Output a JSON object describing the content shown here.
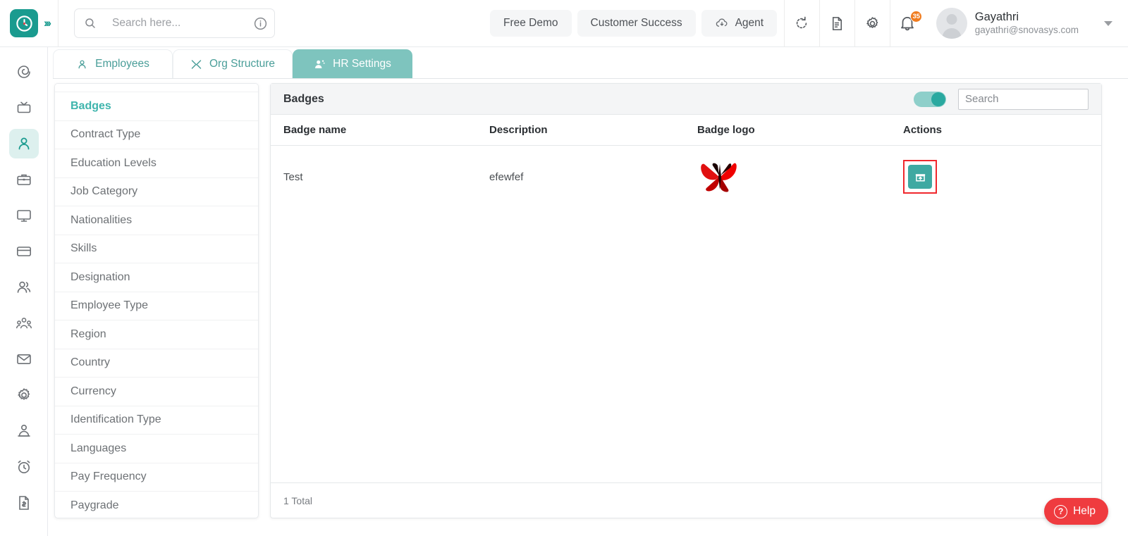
{
  "header": {
    "logo_icon": "clock-logo-icon",
    "collapse_icon": "chevron-double-right-icon",
    "search": {
      "placeholder": "Search here...",
      "value": "",
      "icon": "search-icon",
      "info_icon": "info-circle-icon"
    },
    "buttons": [
      {
        "label": "Free Demo",
        "name": "free-demo-button",
        "icon": ""
      },
      {
        "label": "Customer Success",
        "name": "customer-success-button",
        "icon": ""
      },
      {
        "label": "Agent",
        "name": "agent-button",
        "icon": "cloud-download-icon"
      }
    ],
    "icons": [
      {
        "name": "refresh-icon"
      },
      {
        "name": "document-icon"
      },
      {
        "name": "settings-gear-icon"
      },
      {
        "name": "notifications-bell-icon"
      }
    ],
    "notification_count": "35",
    "user": {
      "name": "Gayathri",
      "email": "gayathri@snovasys.com",
      "avatar": "user-avatar",
      "caret": "chevron-down-icon"
    }
  },
  "rail": {
    "items": [
      {
        "name": "dashboard-spiral-icon",
        "active": false
      },
      {
        "name": "tv-screen-icon",
        "active": false
      },
      {
        "name": "person-icon",
        "active": true
      },
      {
        "name": "briefcase-icon",
        "active": false
      },
      {
        "name": "desktop-monitor-icon",
        "active": false
      },
      {
        "name": "credit-card-icon",
        "active": false
      },
      {
        "name": "users-group-icon",
        "active": false
      },
      {
        "name": "org-people-icon",
        "active": false
      },
      {
        "name": "envelope-mail-icon",
        "active": false
      },
      {
        "name": "gear-settings-icon",
        "active": false
      },
      {
        "name": "admin-person-icon",
        "active": false
      },
      {
        "name": "alarm-clock-icon",
        "active": false
      },
      {
        "name": "invoice-dollar-icon",
        "active": false
      }
    ]
  },
  "tabs": [
    {
      "label": "Employees",
      "icon": "person-outline-icon",
      "active": false
    },
    {
      "label": "Org Structure",
      "icon": "tools-icon",
      "active": false
    },
    {
      "label": "HR Settings",
      "icon": "user-settings-icon",
      "active": true
    }
  ],
  "menu": {
    "items": [
      {
        "label": "Badges",
        "active": true
      },
      {
        "label": "Contract Type",
        "active": false
      },
      {
        "label": "Education Levels",
        "active": false
      },
      {
        "label": "Job Category",
        "active": false
      },
      {
        "label": "Nationalities",
        "active": false
      },
      {
        "label": "Skills",
        "active": false
      },
      {
        "label": "Designation",
        "active": false
      },
      {
        "label": "Employee Type",
        "active": false
      },
      {
        "label": "Region",
        "active": false
      },
      {
        "label": "Country",
        "active": false
      },
      {
        "label": "Currency",
        "active": false
      },
      {
        "label": "Identification Type",
        "active": false
      },
      {
        "label": "Languages",
        "active": false
      },
      {
        "label": "Pay Frequency",
        "active": false
      },
      {
        "label": "Paygrade",
        "active": false
      }
    ]
  },
  "card": {
    "title": "Badges",
    "toggle_on": true,
    "search": {
      "placeholder": "Search",
      "value": ""
    },
    "columns": [
      "Badge name",
      "Description",
      "Badge logo",
      "Actions"
    ],
    "rows": [
      {
        "badge_name": "Test",
        "description": "efewfef",
        "badge_logo": "red-butterfly-image",
        "action_icon": "archive-restore-icon",
        "action_highlighted": true
      }
    ],
    "footer_total": "1 Total"
  },
  "help": {
    "label": "Help",
    "icon": "question-circle-icon"
  },
  "colors": {
    "brand_teal": "#1a9b8f",
    "tab_active": "#7ec4be",
    "menu_active": "#3fb5ad",
    "action_button": "#3fa9a2",
    "highlight_red": "#f0282d",
    "help_red": "#ef3b3f",
    "badge_orange": "#f07c1f"
  }
}
